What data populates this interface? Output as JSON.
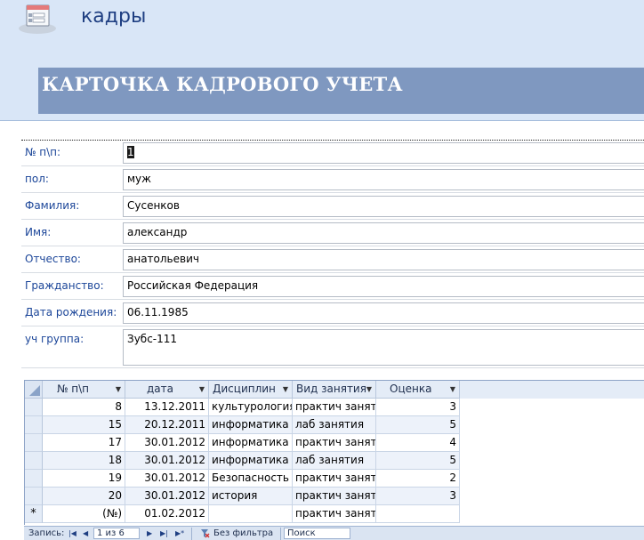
{
  "header": {
    "app_title": "кадры",
    "card_title": "КАРТОЧКА  КАДРОВОГО УЧЕТА",
    "form_icon": "form-icon"
  },
  "form": {
    "fields": [
      {
        "label": "№ п\\п:",
        "value": "1"
      },
      {
        "label": "пол:",
        "value": "муж"
      },
      {
        "label": "Фамилия:",
        "value": "Сусенков"
      },
      {
        "label": "Имя:",
        "value": "александр"
      },
      {
        "label": "Отчество:",
        "value": "анатольевич"
      },
      {
        "label": "Гражданство:",
        "value": "Российская Федерация"
      },
      {
        "label": "Дата рождения:",
        "value": "06.11.1985"
      },
      {
        "label": "уч группа:",
        "value": "Зубс-111"
      }
    ]
  },
  "grid": {
    "columns": [
      "№ п\\п",
      "дата",
      "Дисциплин",
      "Вид занятия",
      "Оценка"
    ],
    "rows": [
      [
        "8",
        "13.12.2011",
        "культурология",
        "практич занят",
        "3"
      ],
      [
        "15",
        "20.12.2011",
        "информатика",
        "лаб занятия",
        "5"
      ],
      [
        "17",
        "30.01.2012",
        "информатика",
        "практич занят",
        "4"
      ],
      [
        "18",
        "30.01.2012",
        "информатика",
        "лаб занятия",
        "5"
      ],
      [
        "19",
        "30.01.2012",
        "Безопасность",
        "практич занят",
        "2"
      ],
      [
        "20",
        "30.01.2012",
        "история",
        "практич занят",
        "3"
      ]
    ],
    "new_row": {
      "marker": "*",
      "id": "(№)",
      "date": "01.02.2012",
      "type": "практич занят"
    }
  },
  "navbar": {
    "record_label": "Запись:",
    "first": "|◀",
    "prev": "◀",
    "position": "1 из 6",
    "next": "▶",
    "last": "▶|",
    "new": "▶*",
    "filter_label": "Без фильтра",
    "search_label": "Поиск"
  }
}
